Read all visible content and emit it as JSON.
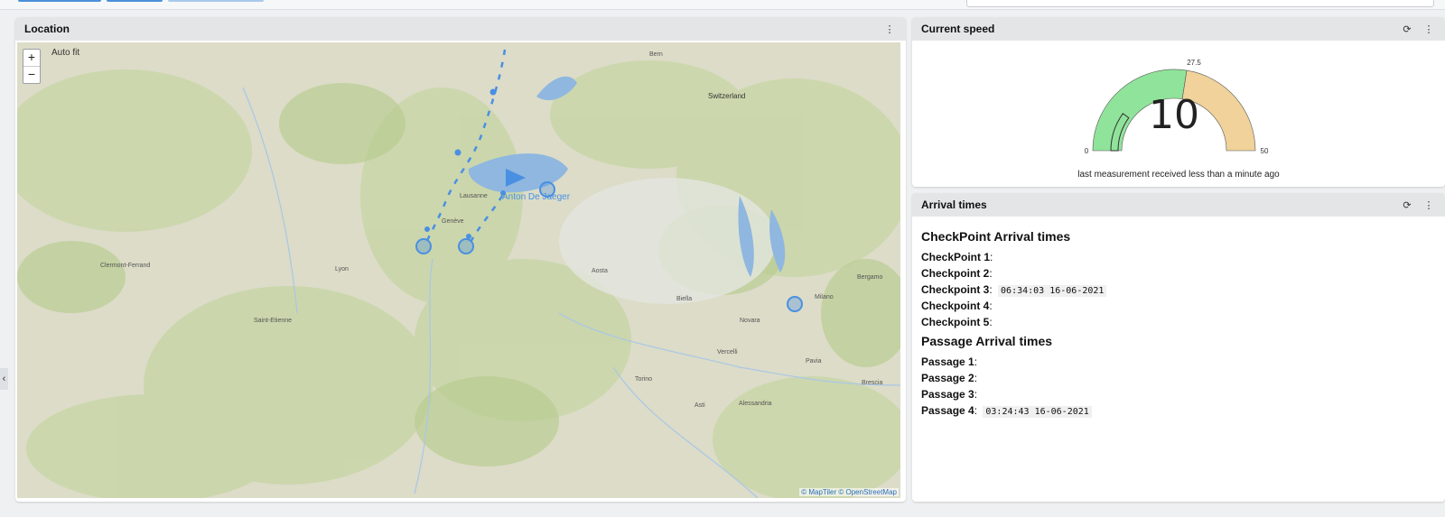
{
  "location": {
    "title": "Location",
    "autofit_label": "Auto fit",
    "zoom_in": "+",
    "zoom_out": "−",
    "attribution": "© MapTiler © OpenStreetMap",
    "rider_label": "Anton De Jaeger",
    "places": [
      "Switzerland",
      "Lyon",
      "Milano",
      "Novara",
      "Torino",
      "Saint-Etienne",
      "Bern",
      "Lausanne",
      "Genève",
      "Aosta",
      "Biella",
      "Pavia",
      "Alessandria",
      "Asti",
      "Vercelli",
      "Clermont-Ferrand",
      "Bergamo",
      "Brescia"
    ],
    "menu_icon": "more-vert-icon"
  },
  "speed": {
    "title": "Current speed",
    "value": "10",
    "min_label": "0",
    "mid_label": "27.5",
    "max_label": "50",
    "caption": "last measurement received less than a minute ago",
    "green_color": "#90e39a",
    "orange_color": "#f0d29a",
    "refresh_icon": "refresh-icon",
    "menu_icon": "more-vert-icon"
  },
  "arrival": {
    "title": "Arrival times",
    "checkpoint_heading": "CheckPoint Arrival times",
    "checkpoints": [
      {
        "label": "CheckPoint 1",
        "time": ""
      },
      {
        "label": "Checkpoint 2",
        "time": ""
      },
      {
        "label": "Checkpoint 3",
        "time": "06:34:03 16-06-2021"
      },
      {
        "label": "Checkpoint 4",
        "time": ""
      },
      {
        "label": "Checkpoint 5",
        "time": ""
      }
    ],
    "passage_heading": "Passage Arrival times",
    "passages": [
      {
        "label": "Passage 1",
        "time": ""
      },
      {
        "label": "Passage 2",
        "time": ""
      },
      {
        "label": "Passage 3",
        "time": ""
      },
      {
        "label": "Passage 4",
        "time": "03:24:43 16-06-2021"
      }
    ],
    "refresh_icon": "refresh-icon",
    "menu_icon": "more-vert-icon"
  },
  "sidebar_toggle": "‹"
}
